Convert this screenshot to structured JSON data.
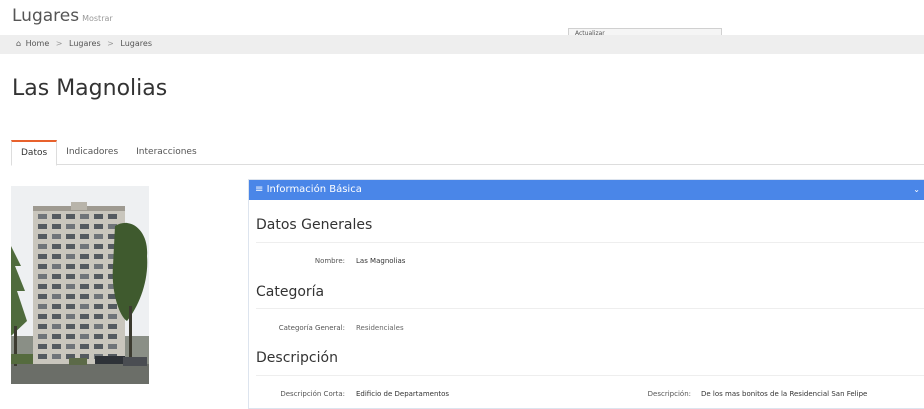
{
  "header": {
    "title": "Lugares",
    "subtitle": "Mostrar"
  },
  "breadcrumb": {
    "home_icon": "home-icon",
    "home_label": "Home",
    "separator": ">",
    "items": [
      "Lugares",
      "Lugares"
    ]
  },
  "toolbar": {
    "update_label": "Actualizar"
  },
  "record": {
    "title": "Las Magnolias"
  },
  "tabs": [
    {
      "label": "Datos",
      "active": true
    },
    {
      "label": "Indicadores",
      "active": false
    },
    {
      "label": "Interacciones",
      "active": false
    }
  ],
  "photo": {
    "subject": "building-photo"
  },
  "panel": {
    "title": "Información Básica",
    "menu_icon": "list-icon",
    "collapse_icon": "chevron-down-icon",
    "sections": {
      "general": {
        "title": "Datos Generales",
        "name_label": "Nombre:",
        "name_value": "Las Magnolias"
      },
      "category": {
        "title": "Categoría",
        "general_label": "Categoría General:",
        "general_value": "Residenciales"
      },
      "description": {
        "title": "Descripción",
        "short_label": "Descripción Corta:",
        "short_value": "Edificio de Departamentos",
        "long_label": "Descripción:",
        "long_value": "De los mas bonitos de la Residencial San Felipe"
      }
    }
  },
  "colors": {
    "accent": "#4a86e8",
    "tab_active": "#e8612c"
  }
}
